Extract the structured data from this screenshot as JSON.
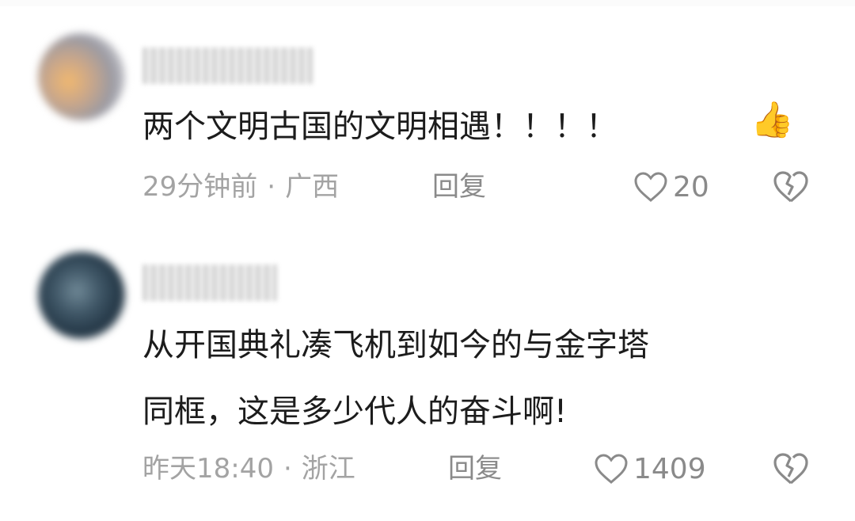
{
  "comments": [
    {
      "text_lines": [
        "两个文明古国的文明相遇！！！！"
      ],
      "emoji": "👍",
      "time": "29分钟前",
      "location": "广西",
      "reply_label": "回复",
      "likes": "20"
    },
    {
      "text_lines": [
        "从开国典礼凑飞机到如今的与金字塔",
        "同框，这是多少代人的奋斗啊!"
      ],
      "time": "昨天18:40",
      "location": "浙江",
      "reply_label": "回复",
      "likes": "1409"
    }
  ],
  "separator": "·",
  "colors": {
    "text": "#1c1c1c",
    "meta": "#a3a3a3",
    "icon": "#8a8a8a",
    "emoji": "#f2b400"
  }
}
